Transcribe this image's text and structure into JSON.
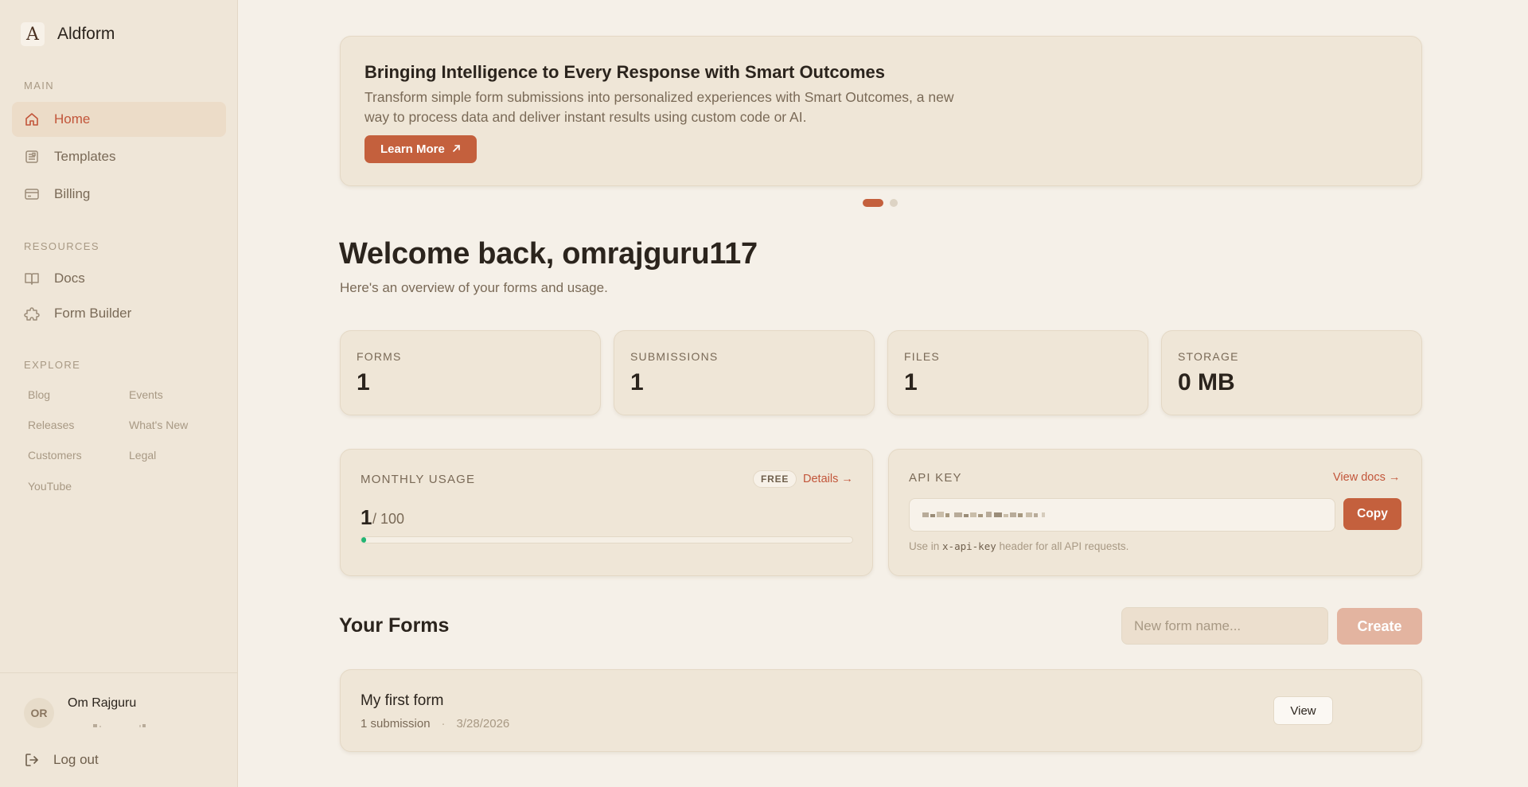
{
  "app": {
    "name": "Aldform",
    "logo_letter": "A"
  },
  "sidebar": {
    "sections": {
      "main": "MAIN",
      "resources": "RESOURCES",
      "explore": "EXPLORE"
    },
    "main_items": [
      {
        "label": "Home",
        "icon": "home-icon",
        "active": true
      },
      {
        "label": "Templates",
        "icon": "templates-icon",
        "active": false
      },
      {
        "label": "Billing",
        "icon": "billing-icon",
        "active": false
      }
    ],
    "resource_items": [
      {
        "label": "Docs",
        "icon": "book-icon"
      },
      {
        "label": "Form Builder",
        "icon": "puzzle-icon"
      }
    ],
    "explore_links": [
      "Blog",
      "Events",
      "Releases",
      "What's New",
      "Customers",
      "Legal",
      "YouTube"
    ],
    "user": {
      "initials": "OR",
      "name": "Om Rajguru"
    },
    "logout_label": "Log out"
  },
  "banner": {
    "title": "Bringing Intelligence to Every Response with Smart Outcomes",
    "text": "Transform simple form submissions into personalized experiences with Smart Outcomes, a new way to process data and deliver instant results using custom code or AI.",
    "button_label": "Learn More",
    "button_icon": "arrow-up-right-icon",
    "slides": 2,
    "active_slide": 1
  },
  "welcome": {
    "title": "Welcome back, omrajguru117",
    "subtitle": "Here's an overview of your forms and usage."
  },
  "stats": [
    {
      "label": "FORMS",
      "value": "1"
    },
    {
      "label": "SUBMISSIONS",
      "value": "1"
    },
    {
      "label": "FILES",
      "value": "1"
    },
    {
      "label": "STORAGE",
      "value": "0 MB"
    }
  ],
  "usage": {
    "label": "MONTHLY USAGE",
    "plan_badge": "FREE",
    "details_link": "Details →",
    "used": "1",
    "limit": "/ 100",
    "fraction": 0.01
  },
  "api_key": {
    "label": "API KEY",
    "docs_link": "View docs →",
    "copy_label": "Copy",
    "hint_before": "Use in ",
    "hint_code": "x-api-key",
    "hint_after": " header for all API requests."
  },
  "forms": {
    "title": "Your Forms",
    "new_placeholder": "New form name...",
    "create_label": "Create",
    "items": [
      {
        "name": "My first form",
        "submissions": "1 submission",
        "separator": "·",
        "date": "3/28/2026",
        "view_label": "View"
      }
    ]
  },
  "colors": {
    "accent": "#c4603d",
    "background": "#f5f0e8",
    "sidebar": "#efe6d8",
    "card": "#efe6d7",
    "progress": "#22b573"
  }
}
